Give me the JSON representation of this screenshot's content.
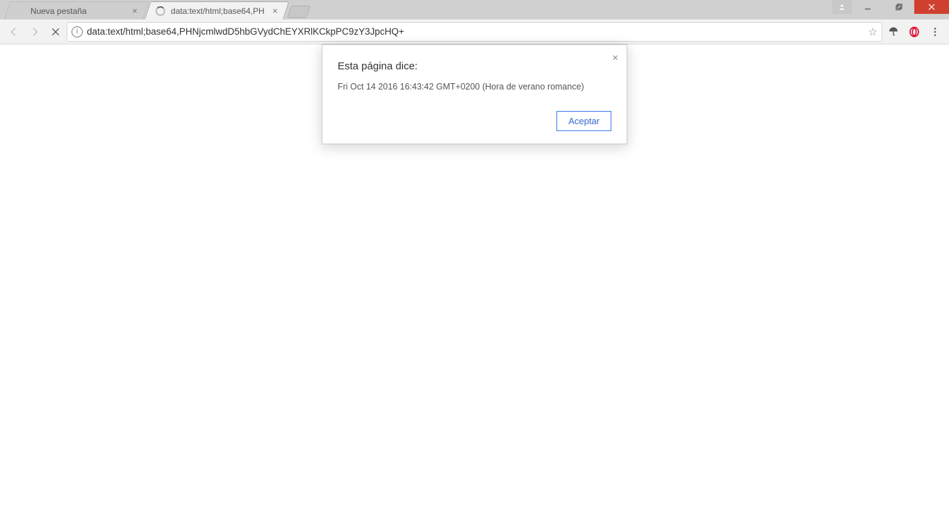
{
  "tabs": {
    "inactive": {
      "label": "Nueva pestaña"
    },
    "active": {
      "label": "data:text/html;base64,PH"
    }
  },
  "omnibox": {
    "url": "data:text/html;base64,PHNjcmlwdD5hbGVydChEYXRlKCkpPC9zY3JpcHQ+"
  },
  "alert": {
    "title": "Esta página dice:",
    "message": "Fri Oct 14 2016 16:43:42 GMT+0200 (Hora de verano romance)",
    "accept": "Aceptar"
  },
  "icons": {
    "back": "back-icon",
    "forward": "forward-icon",
    "stop": "stop-icon",
    "info": "info-icon",
    "star": "star-icon",
    "umbrella": "umbrella-icon",
    "opera": "opera-icon",
    "menu": "menu-icon",
    "close": "close-icon",
    "user": "user-icon",
    "min": "minimize-icon",
    "max": "maximize-icon",
    "x": "window-close-icon",
    "spinner": "loading-spinner-icon",
    "tabclose": "tab-close-icon",
    "newtab": "new-tab-icon"
  }
}
